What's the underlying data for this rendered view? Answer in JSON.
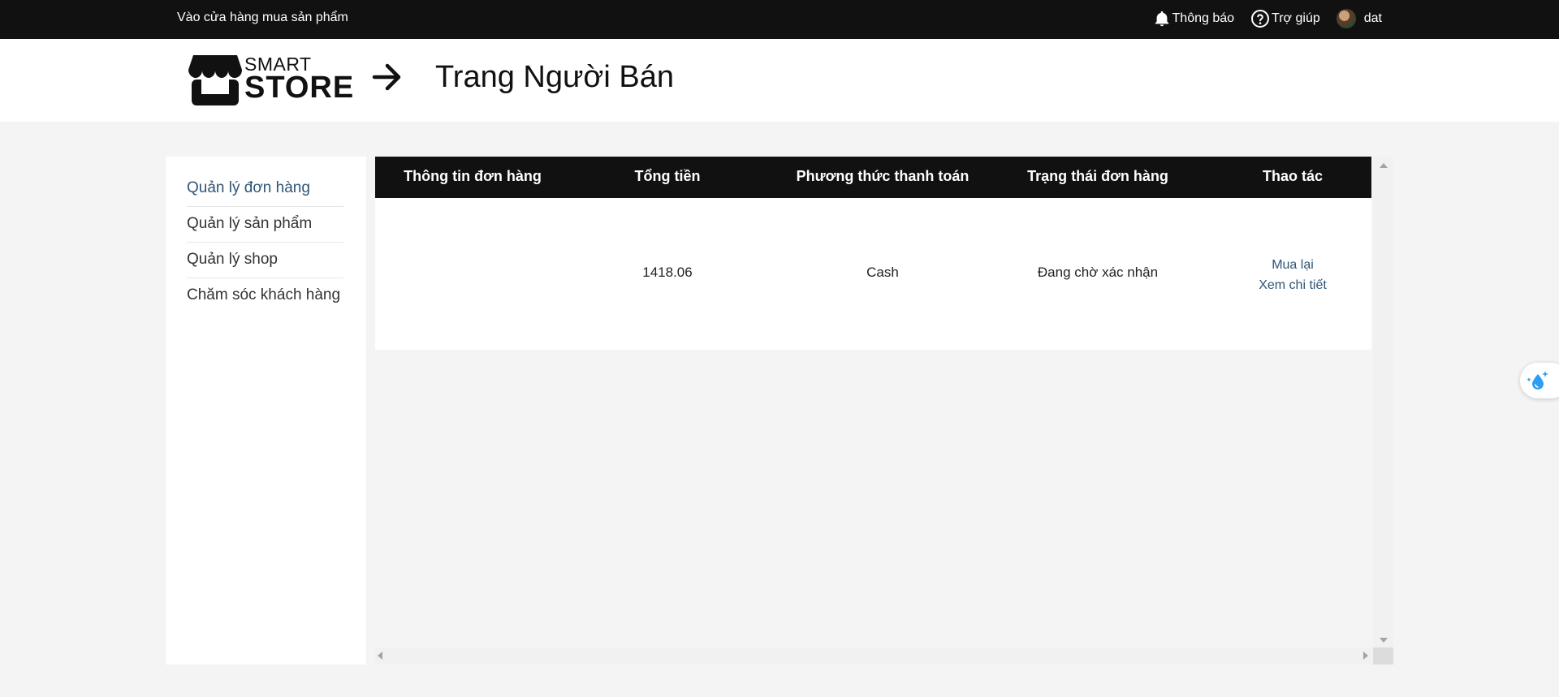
{
  "topbar": {
    "shop_link": "Vào cửa hàng mua sản phẩm",
    "notifications": "Thông báo",
    "help": "Trợ giúp",
    "username": "dat"
  },
  "header": {
    "logo_small": "SMART",
    "logo_big": "STORE",
    "title": "Trang Người Bán"
  },
  "sidebar": {
    "items": [
      {
        "label": "Quản lý đơn hàng"
      },
      {
        "label": "Quản lý sản phẩm"
      },
      {
        "label": "Quản lý shop"
      },
      {
        "label": "Chăm sóc khách hàng"
      }
    ]
  },
  "table": {
    "columns": [
      "Thông tin đơn hàng",
      "Tổng tiền",
      "Phương thức thanh toán",
      "Trạng thái đơn hàng",
      "Thao tác"
    ],
    "rows": [
      {
        "info": "",
        "total": "1418.06",
        "payment": "Cash",
        "status": "Đang chờ xác nhận",
        "actions": [
          "Mua lại",
          "Xem chi tiết"
        ]
      }
    ]
  },
  "colors": {
    "topbar_bg": "#111111",
    "accent_link": "#2e5577",
    "page_bg": "#f4f4f4",
    "float_icon": "#2a9df4"
  },
  "icons": {
    "notifications": "bell-icon",
    "help": "question-circle-icon",
    "header_arrow": "arrow-right-icon",
    "logo": "storefront-icon",
    "float_widget": "sparkle-drop-icon"
  }
}
